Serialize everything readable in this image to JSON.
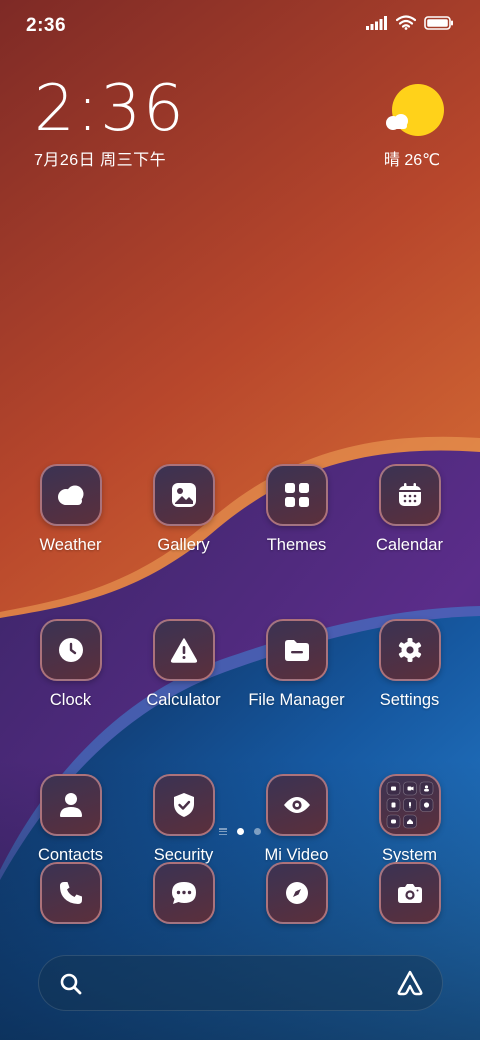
{
  "status_bar": {
    "time": "2:36"
  },
  "clock_widget": {
    "time": "2:36",
    "date": "7月26日 周三下午"
  },
  "weather_widget": {
    "text": "晴 26℃",
    "icon": "sun-cloud-icon"
  },
  "apps": [
    [
      {
        "label": "Weather",
        "icon": "weather-icon"
      },
      {
        "label": "Gallery",
        "icon": "gallery-icon"
      },
      {
        "label": "Themes",
        "icon": "themes-icon"
      },
      {
        "label": "Calendar",
        "icon": "calendar-icon"
      }
    ],
    [
      {
        "label": "Clock",
        "icon": "clock-icon"
      },
      {
        "label": "Calculator",
        "icon": "calculator-icon"
      },
      {
        "label": "File Manager",
        "icon": "file-manager-icon"
      },
      {
        "label": "Settings",
        "icon": "settings-icon"
      }
    ],
    [
      {
        "label": "Contacts",
        "icon": "contacts-icon"
      },
      {
        "label": "Security",
        "icon": "security-icon"
      },
      {
        "label": "Mi Video",
        "icon": "mi-video-icon"
      },
      {
        "label": "System",
        "icon": "system-folder-icon"
      }
    ]
  ],
  "dock": [
    {
      "icon": "phone-icon"
    },
    {
      "icon": "messages-icon"
    },
    {
      "icon": "browser-icon"
    },
    {
      "icon": "camera-icon"
    }
  ],
  "page_indicator": {
    "pages": 2,
    "current": 1
  },
  "colors": {
    "sun": "#ffd21a",
    "wallpaper_top": "#8a3326",
    "wallpaper_orange": "#e07a35",
    "wallpaper_purple": "#4a2a7a",
    "wallpaper_blue": "#1c6fb8"
  }
}
